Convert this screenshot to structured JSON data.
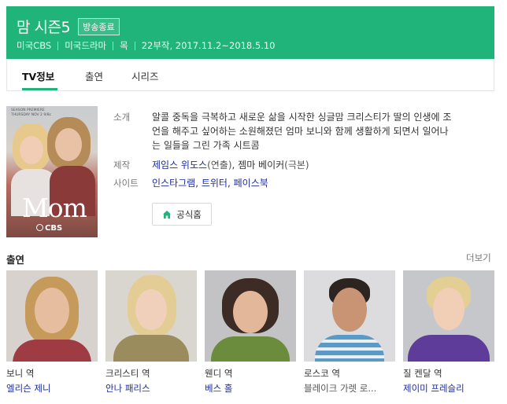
{
  "header": {
    "title": "맘 시즌5",
    "badge": "방송종료",
    "meta": [
      "미국CBS",
      "미국드라마",
      "목",
      "22부작, 2017.11.2~2018.5.10"
    ]
  },
  "tabs": [
    {
      "label": "TV정보",
      "active": true
    },
    {
      "label": "출연",
      "active": false
    },
    {
      "label": "시리즈",
      "active": false
    }
  ],
  "poster": {
    "logo_text": "Mom",
    "network_text": "CBS",
    "small_text": "SEASON PREMIERE THURSDAY NOV 2 9/8c"
  },
  "info": {
    "intro_label": "소개",
    "intro_text": [
      "알콜 중독을 극복하고 새로운 삶을 시작한 싱글맘 크리스티가 딸의 인생에 조",
      "언을 해주고 싶어하는 소원해졌던 엄마 보니와 함께 생활하게 되면서 일어나",
      "는 일들을 그린 가족 시트콤"
    ],
    "production_label": "제작",
    "production": [
      {
        "name": "제임스 위도스",
        "role": "(연출)"
      },
      {
        "name": "젬마 베이커",
        "role": "(극본)"
      }
    ],
    "production_sep": ", ",
    "site_label": "사이트",
    "sites": [
      "인스타그램",
      "트위터",
      "페이스북"
    ],
    "site_sep": ", ",
    "home_button": "공식홈"
  },
  "cast": {
    "title": "출연",
    "more": "더보기",
    "members": [
      {
        "role": "보니 역",
        "name": "엘리슨 제니",
        "linked": true
      },
      {
        "role": "크리스티 역",
        "name": "안나 패리스",
        "linked": true
      },
      {
        "role": "웬디 역",
        "name": "베스 홀",
        "linked": true
      },
      {
        "role": "로스코 역",
        "name": "블레이크 가렛 로...",
        "linked": false
      },
      {
        "role": "질 켄달 역",
        "name": "제이미 프레슬리",
        "linked": true
      }
    ]
  },
  "colors": {
    "brand": "#20b47a",
    "link": "#1c2c99"
  },
  "icons": {
    "home": "home-icon"
  }
}
